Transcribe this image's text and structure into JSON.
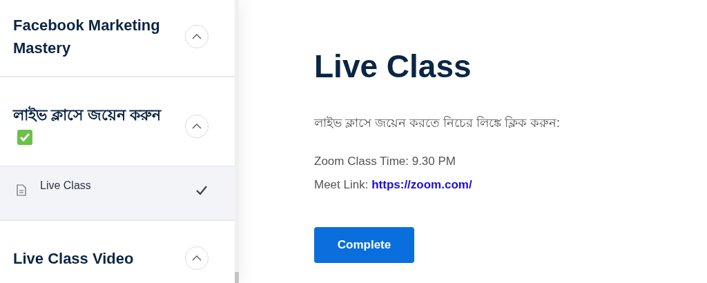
{
  "sidebar": {
    "sections": [
      {
        "title": "Facebook Marketing Mastery",
        "completed": false
      },
      {
        "title": "লাইভ ক্লাসে জয়েন করুন",
        "completed": true,
        "lessons": [
          {
            "title": "Live Class",
            "done": true,
            "selected": true
          }
        ]
      },
      {
        "title": "Live Class Video",
        "completed": false
      }
    ]
  },
  "main": {
    "title": "Live Class",
    "intro": "লাইভ ক্লাসে জয়েন করতে নিচের লিঙ্কে ক্লিক করুন:",
    "time": "Zoom Class Time: 9.30 PM",
    "link_label": "Meet Link:",
    "link": "https://zoom.com/",
    "button": "Complete"
  }
}
